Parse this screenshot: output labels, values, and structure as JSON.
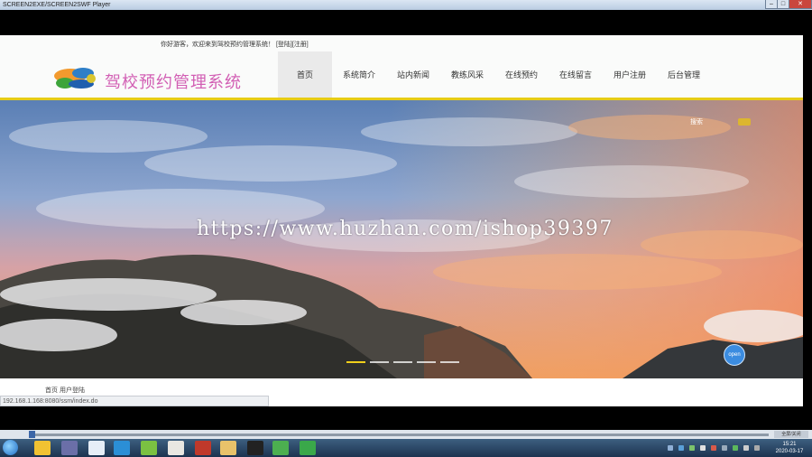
{
  "window": {
    "title": "SCREEN2EXE/SCREEN2SWF Player",
    "min": "–",
    "max": "□",
    "close": "✕"
  },
  "site": {
    "welcome": "你好游客，欢迎来到驾校预约管理系统！ [登陆][注册]",
    "title": "驾校预约管理系统",
    "nav": [
      "首页",
      "系统简介",
      "站内新闻",
      "教练风采",
      "在线预约",
      "在线留言",
      "用户注册",
      "后台管理"
    ],
    "active_nav": 0,
    "search_label": "搜索",
    "watermark": "https://www.huzhan.com/ishop39397",
    "slider": {
      "count": 5,
      "active": 0
    },
    "float_button": "open",
    "breadcrumb": "首页 用户登陆"
  },
  "browser": {
    "status_url": "192.168.1.168:8080/ssm/index.do"
  },
  "player": {
    "speed": "全屏/关闭"
  },
  "taskbar": {
    "time": "15:21",
    "date": "2020-03-17"
  }
}
